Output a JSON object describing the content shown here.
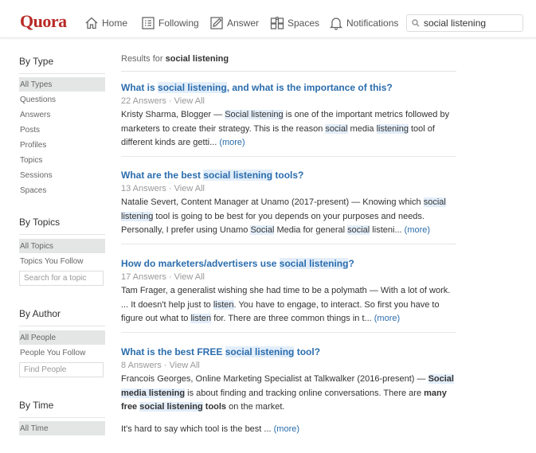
{
  "header": {
    "logo": "Quora",
    "nav": [
      {
        "label": "Home",
        "icon": "home-icon"
      },
      {
        "label": "Following",
        "icon": "following-icon"
      },
      {
        "label": "Answer",
        "icon": "answer-pencil-icon"
      },
      {
        "label": "Spaces",
        "icon": "spaces-icon"
      },
      {
        "label": "Notifications",
        "icon": "bell-icon"
      }
    ],
    "search_value": "social listening"
  },
  "sidebar": {
    "by_type": {
      "heading": "By Type",
      "items": [
        "All Types",
        "Questions",
        "Answers",
        "Posts",
        "Profiles",
        "Topics",
        "Sessions",
        "Spaces"
      ]
    },
    "by_topics": {
      "heading": "By Topics",
      "items": [
        "All Topics",
        "Topics You Follow"
      ],
      "search_placeholder": "Search for a topic"
    },
    "by_author": {
      "heading": "By Author",
      "items": [
        "All People",
        "People You Follow"
      ],
      "search_placeholder": "Find People"
    },
    "by_time": {
      "heading": "By Time",
      "items": [
        "All Time"
      ]
    }
  },
  "main": {
    "results_prefix": "Results for",
    "query": "social listening",
    "results": [
      {
        "title_parts": [
          "What is ",
          "social listening",
          ", and what is the importance of this?"
        ],
        "answers": "22 Answers",
        "view_all": "View All",
        "body_parts": [
          "Kristy Sharma, Blogger — ",
          "Social listening",
          " is one of the important metrics followed by marketers to create their strategy. This is the reason ",
          "social",
          " media ",
          "listening",
          " tool of different kinds are getti... "
        ],
        "more": "(more)"
      },
      {
        "title_parts": [
          "What are the best ",
          "social listening",
          " tools?"
        ],
        "answers": "13 Answers",
        "view_all": "View All",
        "body_parts": [
          "Natalie Severt, Content Manager at Unamo (2017-present) — Knowing which ",
          "social",
          " ",
          "listening",
          " tool is going to be best for you depends on your purposes and needs. Personally, I prefer using Unamo ",
          "Social",
          " Media for general ",
          "social",
          " listeni... "
        ],
        "more": "(more)"
      },
      {
        "title_parts": [
          "How do marketers/advertisers use ",
          "social listening",
          "?"
        ],
        "answers": "17 Answers",
        "view_all": "View All",
        "body_parts": [
          "Tam Frager, a generalist wishing she had time to be a polymath — With a lot of work. ... It doesn't help just to ",
          "listen",
          ". You have to engage, to interact. So first you have to figure out what to ",
          "listen",
          " for. There are three common things in t... "
        ],
        "more": "(more)"
      },
      {
        "title_parts": [
          "What is the best FREE ",
          "social listening",
          " tool?"
        ],
        "answers": "8 Answers",
        "view_all": "View All",
        "body_parts": [
          "Francois Georges, Online Marketing Specialist at Talkwalker (2016-present) — ",
          "Social media listening",
          " is about finding and tracking online conversations. There are ",
          "many free ",
          "social listening",
          " tools",
          " on the market."
        ],
        "body2": "It's hard to say which tool is the best ... ",
        "more": "(more)"
      }
    ]
  },
  "colors": {
    "brand": "#b92b27",
    "link": "#2b6dad",
    "highlight": "#e3eefa"
  }
}
